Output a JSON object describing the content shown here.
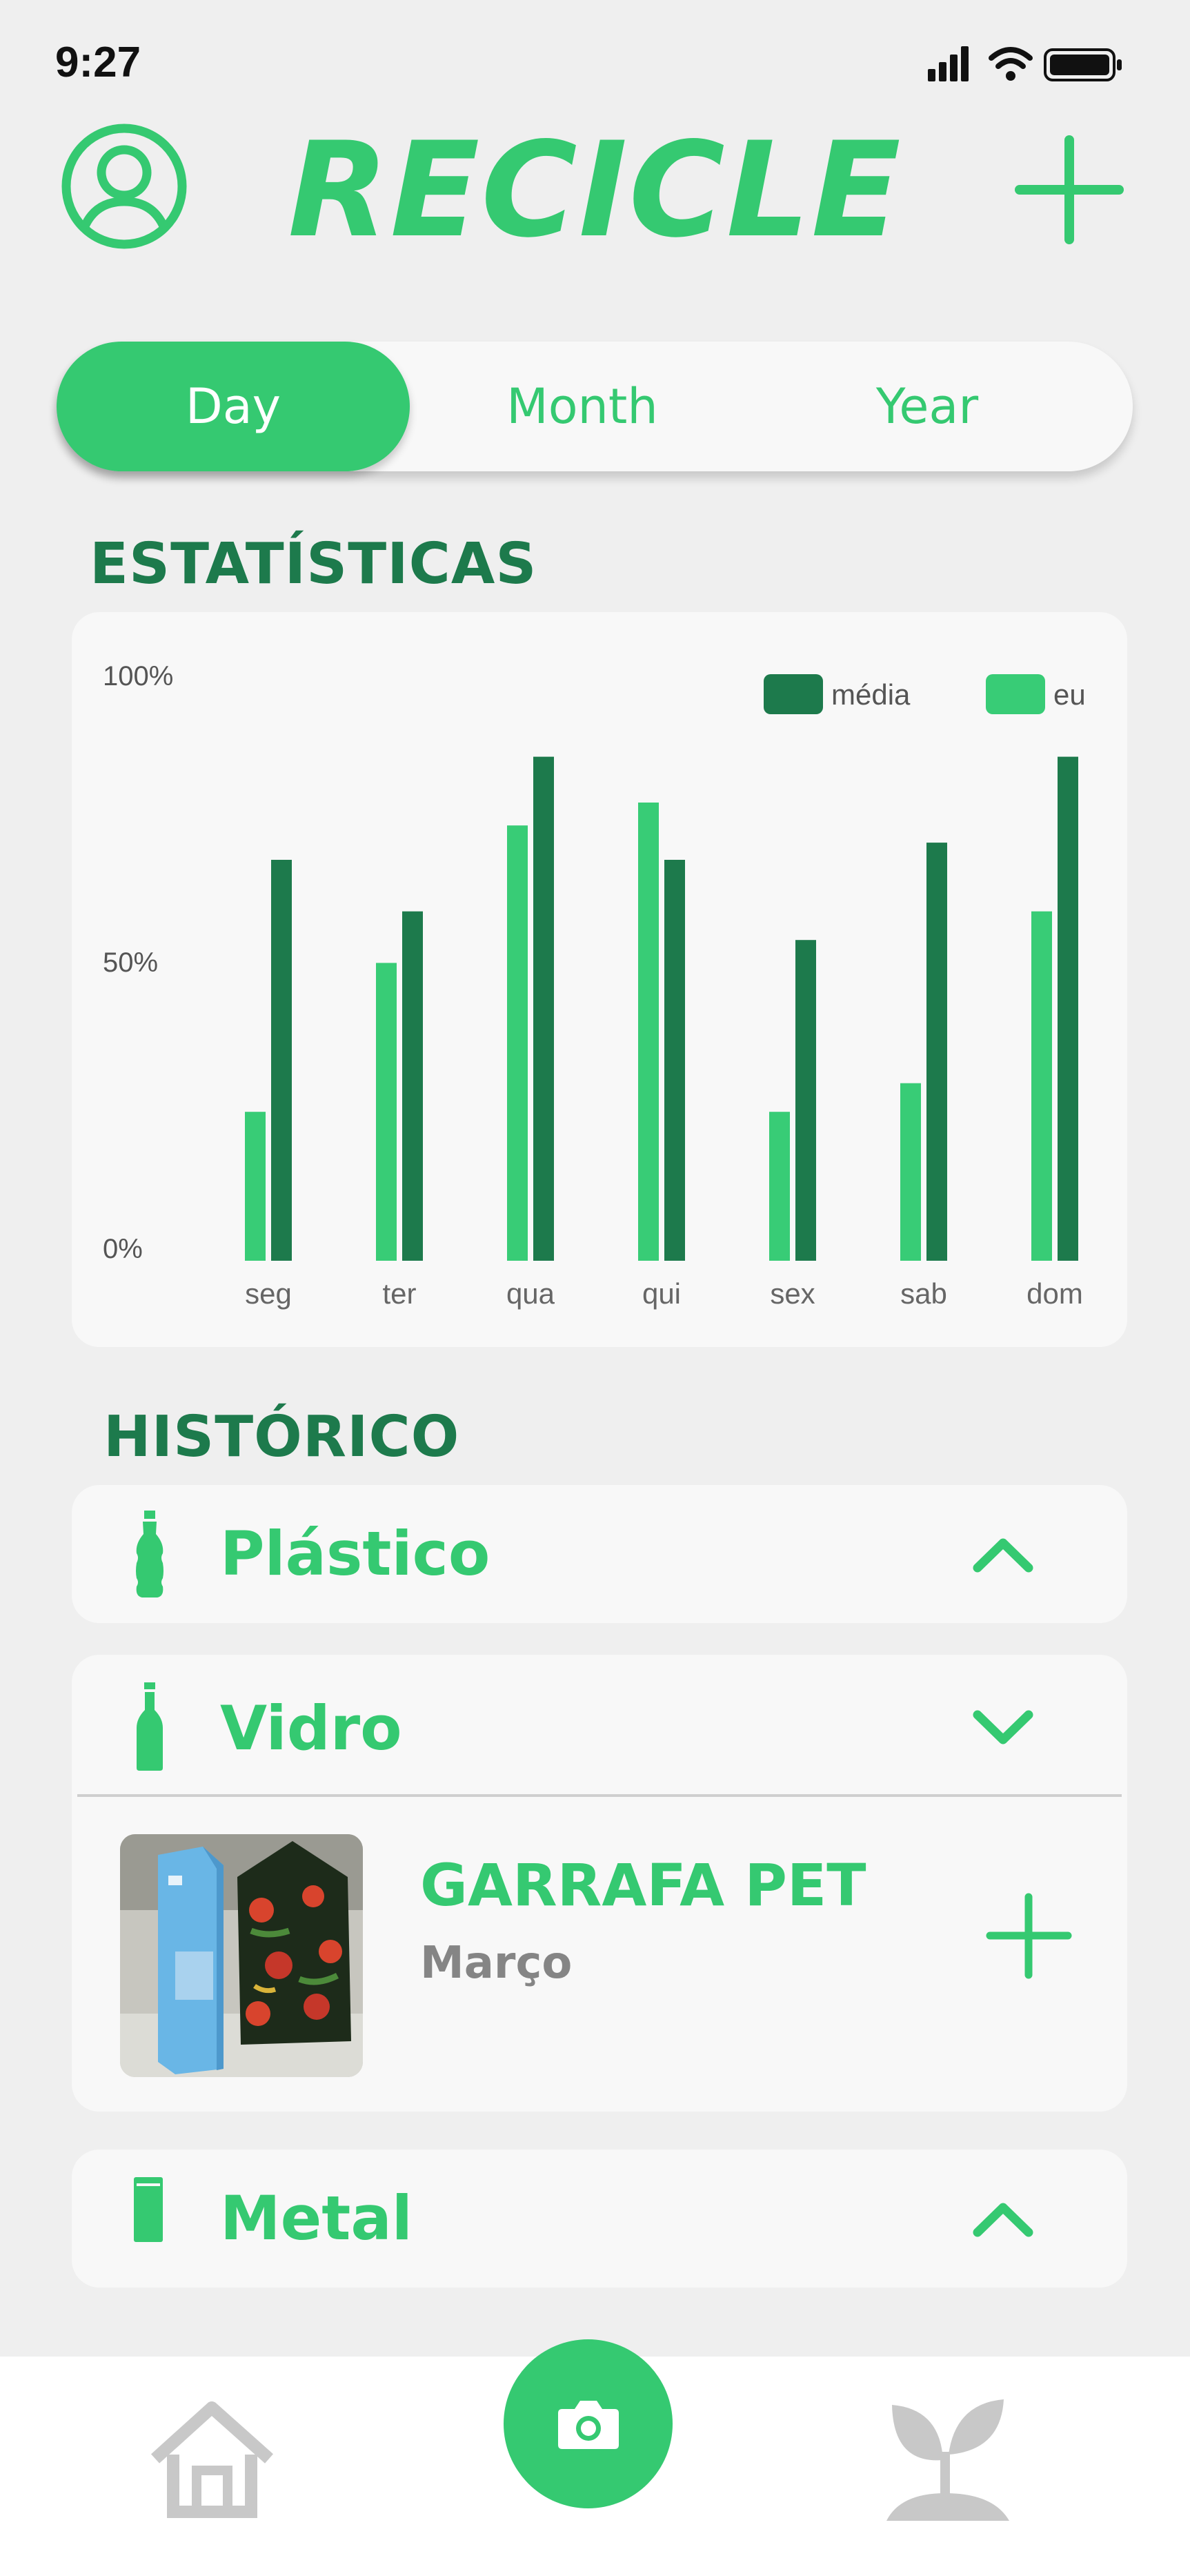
{
  "status_bar": {
    "time": "9:27"
  },
  "header": {
    "title": "RECICLE"
  },
  "segmented": {
    "day": "Day",
    "month": "Month",
    "year": "Year",
    "selected": "Day"
  },
  "stats": {
    "title": "ESTATÍSTICAS"
  },
  "chart_data": {
    "type": "bar",
    "categories": [
      "seg",
      "ter",
      "qua",
      "qui",
      "sex",
      "sab",
      "dom"
    ],
    "series": [
      {
        "name": "eu",
        "color": "#38cc76",
        "values": [
          26,
          52,
          76,
          80,
          26,
          31,
          61
        ]
      },
      {
        "name": "média",
        "color": "#1d7a4c",
        "values": [
          70,
          61,
          88,
          70,
          56,
          73,
          88
        ]
      }
    ],
    "y_ticks": [
      "100%",
      "50%",
      "0%"
    ],
    "ylim": [
      0,
      100
    ],
    "legend_position": "top-right",
    "grid": false
  },
  "history": {
    "title": "HISTÓRICO",
    "categories": [
      {
        "label": "Plástico",
        "icon": "plastic-bottle-icon",
        "expanded": false
      },
      {
        "label": "Vidro",
        "icon": "glass-bottle-icon",
        "expanded": true
      },
      {
        "label": "Metal",
        "icon": "can-icon",
        "expanded": false
      }
    ],
    "item": {
      "name": "GARRAFA PET",
      "date": "Março"
    }
  },
  "colors": {
    "accent": "#35c971",
    "dark_green": "#1d7a4c",
    "background": "#efefef",
    "card": "#f8f8f8",
    "nav_icon": "#c8c8c8"
  }
}
